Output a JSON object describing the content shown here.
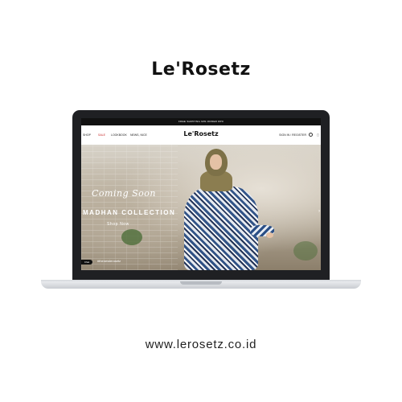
{
  "brand_title": "Le'Rosetz",
  "website_url": "www.lerosetz.co.id",
  "website": {
    "topbar_text": "FREE SHIPPING MIN.ORDER RP0",
    "nav": {
      "items": [
        "SHOP",
        "SALE",
        "LOOKBOOK",
        "NEWS, NICE"
      ],
      "logo": "Le'Rosetz",
      "right_link": "SIGN IN / REGISTER",
      "bag_count": "0"
    },
    "hero": {
      "script_heading": "Coming Soon",
      "collection_title": "MADHAN COLLECTION",
      "cta_label": "Shop Now",
      "hashtag": "#thenewlerosetz",
      "chat_label": "Chat"
    }
  },
  "colors": {
    "sale_accent": "#c62828",
    "bezel": "#1f2023",
    "dress_primary": "#2b4f86"
  }
}
